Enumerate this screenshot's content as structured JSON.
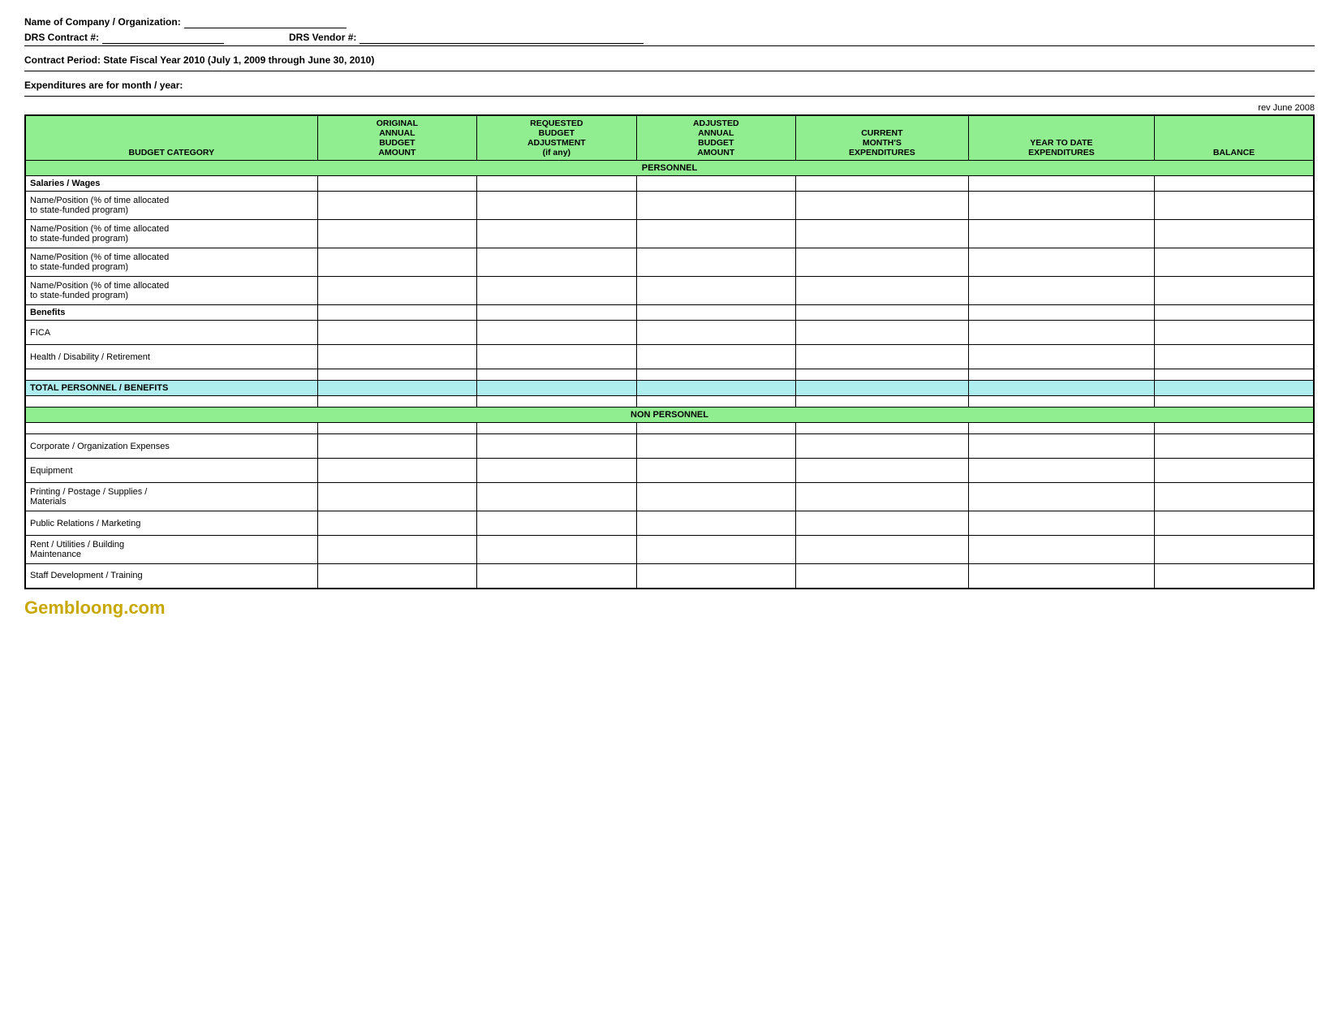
{
  "header": {
    "company_label": "Name of Company / Organization:",
    "company_value": "",
    "drs_contract_label": "DRS Contract #:",
    "drs_contract_value": "",
    "drs_vendor_label": "DRS Vendor #:",
    "drs_vendor_value": "",
    "contract_period_label": "Contract Period:",
    "contract_period_value": "State Fiscal Year 2010 (July 1, 2009 through June 30, 2010)",
    "expenditures_label": "Expenditures are for month / year:",
    "rev_note": "rev June 2008"
  },
  "table": {
    "columns": {
      "budget_category": "BUDGET CATEGORY",
      "original_annual_budget": "ORIGINAL ANNUAL BUDGET AMOUNT",
      "requested_budget_adjustment": "REQUESTED BUDGET ADJUSTMENT (if any)",
      "adjusted_annual_budget": "ADJUSTED ANNUAL BUDGET AMOUNT",
      "current_months_expenditures": "CURRENT MONTH'S EXPENDITURES",
      "year_to_date_expenditures": "YEAR TO DATE EXPENDITURES",
      "balance": "BALANCE"
    },
    "sections": [
      {
        "type": "section-header",
        "label": "PERSONNEL"
      },
      {
        "type": "subsection-header",
        "label": "Salaries / Wages"
      },
      {
        "type": "data-row",
        "label": "Name/Position (% of time allocated to state-funded program)",
        "two_line": true
      },
      {
        "type": "data-row",
        "label": "Name/Position (% of time allocated to state-funded program)",
        "two_line": true
      },
      {
        "type": "data-row",
        "label": "Name/Position (% of time allocated to state-funded program)",
        "two_line": true
      },
      {
        "type": "data-row",
        "label": "Name/Position (% of time allocated to state-funded program)",
        "two_line": true
      },
      {
        "type": "subsection-header",
        "label": "Benefits"
      },
      {
        "type": "simple-row",
        "label": "FICA"
      },
      {
        "type": "simple-row",
        "label": "Health / Disability / Retirement"
      },
      {
        "type": "empty-row",
        "label": ""
      },
      {
        "type": "total-row",
        "label": "TOTAL PERSONNEL / BENEFITS"
      },
      {
        "type": "empty-row",
        "label": ""
      },
      {
        "type": "section-header",
        "label": "NON PERSONNEL"
      },
      {
        "type": "empty-row",
        "label": ""
      },
      {
        "type": "simple-row",
        "label": "Corporate / Organization Expenses"
      },
      {
        "type": "simple-row",
        "label": "Equipment"
      },
      {
        "type": "two-line-row",
        "label": "Printing / Postage / Supplies / Materials"
      },
      {
        "type": "simple-row",
        "label": "Public Relations / Marketing"
      },
      {
        "type": "two-line-row",
        "label": "Rent / Utilities / Building Maintenance"
      },
      {
        "type": "simple-row",
        "label": "Staff Development / Training"
      }
    ]
  },
  "watermark": "Gembloong.com"
}
